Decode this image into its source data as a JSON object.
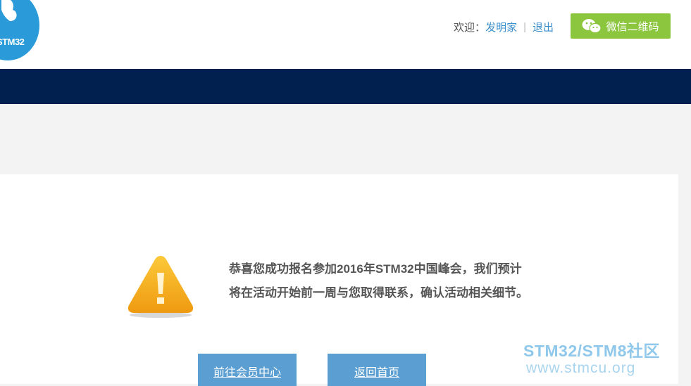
{
  "header": {
    "logo_text": "STM32",
    "welcome_label": "欢迎：",
    "username": "发明家",
    "separator": "|",
    "logout_label": "退出",
    "wechat_button_label": "微信二维码"
  },
  "colors": {
    "brand_blue": "#2a9bd8",
    "navbar": "#01204f",
    "wechat_green": "#8bc63e",
    "button_blue": "#5b9fd2",
    "link_blue": "#3a8ecb"
  },
  "notice": {
    "icon": "warning-icon",
    "line1": "恭喜您成功报名参加2016年STM32中国峰会，我们预计",
    "line2": "将在活动开始前一周与您取得联系，确认活动相关细节。"
  },
  "actions": {
    "member_center_label": "前往会员中心",
    "home_label": "返回首页"
  },
  "watermark": {
    "title": "STM32/STM8社区",
    "url": "www.stmcu.org"
  }
}
